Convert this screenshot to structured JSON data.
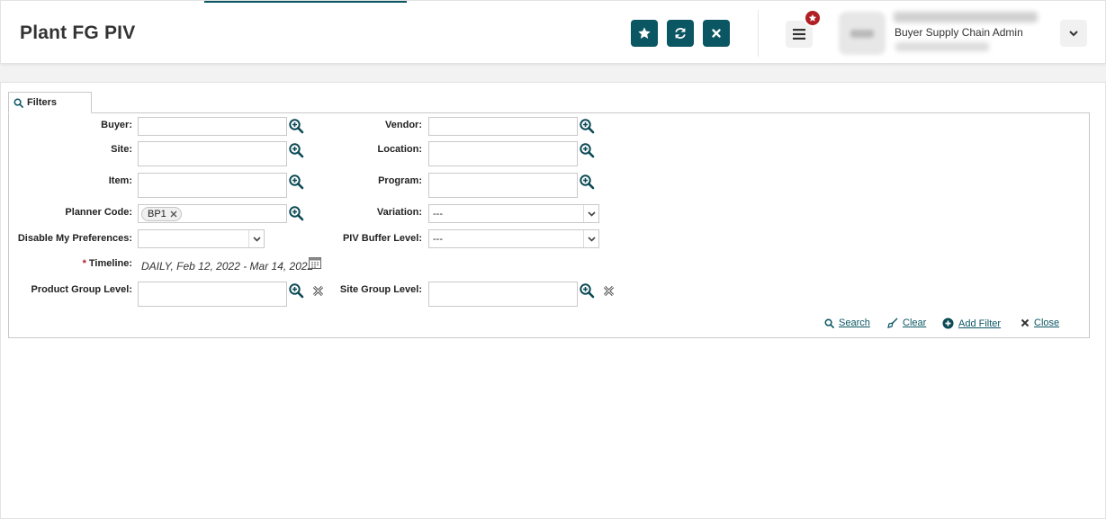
{
  "page": {
    "title": "Plant FG PIV"
  },
  "header": {
    "buttons": {
      "favorite_icon": "star-icon",
      "refresh_icon": "refresh-icon",
      "close_icon": "close-icon"
    },
    "menu_icon": "hamburger-menu-icon",
    "notification_icon": "star-badge-icon"
  },
  "user": {
    "role": "Buyer Supply Chain Admin",
    "dropdown_icon": "chevron-down-icon"
  },
  "filters": {
    "tab_label": "Filters",
    "fields": {
      "buyer": {
        "label": "Buyer:",
        "value": ""
      },
      "vendor": {
        "label": "Vendor:",
        "value": ""
      },
      "site": {
        "label": "Site:",
        "value": ""
      },
      "location": {
        "label": "Location:",
        "value": ""
      },
      "item": {
        "label": "Item:",
        "value": ""
      },
      "program": {
        "label": "Program:",
        "value": ""
      },
      "planner_code": {
        "label": "Planner Code:",
        "chips": [
          "BP1"
        ]
      },
      "variation": {
        "label": "Variation:",
        "value": "---"
      },
      "disable_prefs": {
        "label": "Disable My Preferences:",
        "value": ""
      },
      "piv_buffer_level": {
        "label": "PIV Buffer Level:",
        "value": "---"
      },
      "timeline": {
        "label": "Timeline:",
        "required_mark": "*",
        "value": "DAILY, Feb 12, 2022 - Mar 14, 2022"
      },
      "product_group_level": {
        "label": "Product Group Level:",
        "value": ""
      },
      "site_group_level": {
        "label": "Site Group Level:",
        "value": ""
      }
    },
    "actions": {
      "search": "Search",
      "clear": "Clear",
      "add_filter": "Add Filter",
      "close": "Close"
    }
  },
  "colors": {
    "accent": "#0b5663",
    "badge": "#b01f24"
  }
}
